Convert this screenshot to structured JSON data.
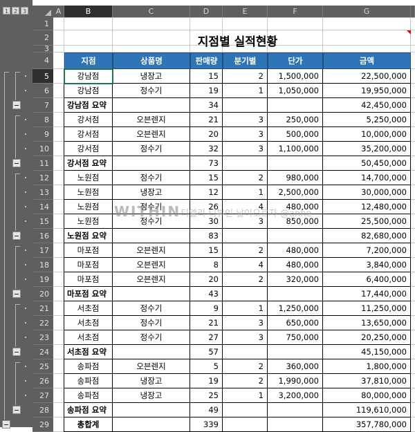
{
  "outline_levels": [
    "1",
    "2",
    "3"
  ],
  "columns": [
    "A",
    "B",
    "C",
    "D",
    "E",
    "F",
    "G"
  ],
  "selected_column": "B",
  "selected_row": "5",
  "title": "지점별 실적현황",
  "header": [
    "지점",
    "상품명",
    "판매량",
    "분기별",
    "단가",
    "금액"
  ],
  "row_numbers": [
    "1",
    "2",
    "3",
    "4",
    "5",
    "6",
    "7",
    "8",
    "9",
    "10",
    "11",
    "12",
    "13",
    "14",
    "15",
    "16",
    "17",
    "18",
    "19",
    "20",
    "21",
    "22",
    "23",
    "24",
    "25",
    "26",
    "27",
    "28",
    "29"
  ],
  "rows": [
    {
      "type": "data",
      "branch": "강남점",
      "product": "냉장고",
      "qty": "15",
      "quarter": "2",
      "price": "1,500,000",
      "amount": "22,500,000"
    },
    {
      "type": "data",
      "branch": "강남점",
      "product": "정수기",
      "qty": "19",
      "quarter": "1",
      "price": "1,050,000",
      "amount": "19,950,000"
    },
    {
      "type": "sub",
      "branch": "강남점 요약",
      "product": "",
      "qty": "34",
      "quarter": "",
      "price": "",
      "amount": "42,450,000"
    },
    {
      "type": "data",
      "branch": "강서점",
      "product": "오븐렌지",
      "qty": "21",
      "quarter": "3",
      "price": "250,000",
      "amount": "5,250,000"
    },
    {
      "type": "data",
      "branch": "강서점",
      "product": "오븐렌지",
      "qty": "20",
      "quarter": "3",
      "price": "500,000",
      "amount": "10,000,000"
    },
    {
      "type": "data",
      "branch": "강서점",
      "product": "정수기",
      "qty": "32",
      "quarter": "3",
      "price": "1,100,000",
      "amount": "35,200,000"
    },
    {
      "type": "sub",
      "branch": "강서점 요약",
      "product": "",
      "qty": "73",
      "quarter": "",
      "price": "",
      "amount": "50,450,000"
    },
    {
      "type": "data",
      "branch": "노원점",
      "product": "정수기",
      "qty": "15",
      "quarter": "2",
      "price": "980,000",
      "amount": "14,700,000"
    },
    {
      "type": "data",
      "branch": "노원점",
      "product": "냉장고",
      "qty": "12",
      "quarter": "1",
      "price": "2,500,000",
      "amount": "30,000,000"
    },
    {
      "type": "data",
      "branch": "노원점",
      "product": "정수기",
      "qty": "26",
      "quarter": "4",
      "price": "480,000",
      "amount": "12,480,000"
    },
    {
      "type": "data",
      "branch": "노원점",
      "product": "정수기",
      "qty": "30",
      "quarter": "3",
      "price": "850,000",
      "amount": "25,500,000"
    },
    {
      "type": "sub",
      "branch": "노원점 요약",
      "product": "",
      "qty": "83",
      "quarter": "",
      "price": "",
      "amount": "82,680,000"
    },
    {
      "type": "data",
      "branch": "마포점",
      "product": "오븐렌지",
      "qty": "15",
      "quarter": "2",
      "price": "480,000",
      "amount": "7,200,000"
    },
    {
      "type": "data",
      "branch": "마포점",
      "product": "오븐렌지",
      "qty": "8",
      "quarter": "4",
      "price": "480,000",
      "amount": "3,840,000"
    },
    {
      "type": "data",
      "branch": "마포점",
      "product": "오븐렌지",
      "qty": "20",
      "quarter": "2",
      "price": "320,000",
      "amount": "6,400,000"
    },
    {
      "type": "sub",
      "branch": "마포점 요약",
      "product": "",
      "qty": "43",
      "quarter": "",
      "price": "",
      "amount": "17,440,000"
    },
    {
      "type": "data",
      "branch": "서초점",
      "product": "정수기",
      "qty": "9",
      "quarter": "1",
      "price": "1,250,000",
      "amount": "11,250,000"
    },
    {
      "type": "data",
      "branch": "서초점",
      "product": "정수기",
      "qty": "21",
      "quarter": "3",
      "price": "650,000",
      "amount": "13,650,000"
    },
    {
      "type": "data",
      "branch": "서초점",
      "product": "정수기",
      "qty": "27",
      "quarter": "3",
      "price": "750,000",
      "amount": "20,250,000"
    },
    {
      "type": "sub",
      "branch": "서초점 요약",
      "product": "",
      "qty": "57",
      "quarter": "",
      "price": "",
      "amount": "45,150,000"
    },
    {
      "type": "data",
      "branch": "송파점",
      "product": "오븐렌지",
      "qty": "5",
      "quarter": "2",
      "price": "360,000",
      "amount": "1,800,000"
    },
    {
      "type": "data",
      "branch": "송파점",
      "product": "냉장고",
      "qty": "19",
      "quarter": "2",
      "price": "1,990,000",
      "amount": "37,810,000"
    },
    {
      "type": "data",
      "branch": "송파점",
      "product": "냉장고",
      "qty": "25",
      "quarter": "1",
      "price": "3,200,000",
      "amount": "80,000,000"
    },
    {
      "type": "sub",
      "branch": "송파점 요약",
      "product": "",
      "qty": "49",
      "quarter": "",
      "price": "",
      "amount": "119,610,000"
    },
    {
      "type": "total",
      "branch": "총합계",
      "product": "",
      "qty": "339",
      "quarter": "",
      "price": "",
      "amount": "357,780,000"
    }
  ],
  "watermark": {
    "brand": "WITHIN",
    "text": "티엘리 티뷰인 날이오르자 @anne"
  },
  "colors": {
    "header_fill": "#2f75b5",
    "gutter": "#5f5f5f",
    "selected_header": "#2f2f2f",
    "selection_border": "#217346"
  }
}
